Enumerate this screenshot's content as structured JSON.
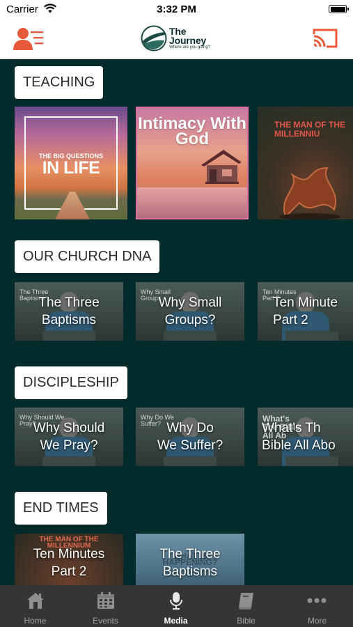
{
  "status_bar": {
    "carrier": "Carrier",
    "time": "3:32 PM"
  },
  "header": {
    "logo_title_line1": "The",
    "logo_title_line2": "Journey",
    "logo_tagline": "Where are you going?",
    "accent_color": "#e85a3a"
  },
  "sections": [
    {
      "title": "TEACHING",
      "items": [
        {
          "label": "THE BIG QUESTIONS",
          "label2": "IN LIFE"
        },
        {
          "label": "Intimacy With God"
        },
        {
          "label": "THE MAN OF THE\nMILLENNIU"
        }
      ]
    },
    {
      "title": "OUR CHURCH DNA",
      "items": [
        {
          "label": "The Three\nBaptisms",
          "thumb_text": "The Three\nBaptisms"
        },
        {
          "label": "Why Small\nGroups?",
          "thumb_text": "Why Small\nGroups"
        },
        {
          "label": "Ten Minute\nPart 2",
          "thumb_text": "Ten Minutes\nPart 2"
        }
      ]
    },
    {
      "title": "DISCIPLESHIP",
      "items": [
        {
          "label": "Why Should\nWe Pray?",
          "thumb_text": "Why Should We\nPray?"
        },
        {
          "label": "Why Do\nWe Suffer?",
          "thumb_text": "Why Do We\nSuffer?"
        },
        {
          "label": "What's Th\nBible All Abo",
          "thumb_text": "What's\nThe Bible\nAll Ab"
        }
      ]
    },
    {
      "title": "END TIMES",
      "items": [
        {
          "label": "Ten Minutes\nPart 2",
          "thumb_text": "THE MAN OF THE\nMILLENNIUM"
        },
        {
          "label": "The Three\nBaptisms",
          "thumb_text": "WHAT IS\nHAPPENING?"
        }
      ]
    }
  ],
  "tabs": [
    {
      "label": "Home",
      "icon": "house-icon"
    },
    {
      "label": "Events",
      "icon": "calendar-icon"
    },
    {
      "label": "Media",
      "icon": "microphone-icon",
      "active": true
    },
    {
      "label": "Bible",
      "icon": "book-icon"
    },
    {
      "label": "More",
      "icon": "ellipsis-icon"
    }
  ]
}
